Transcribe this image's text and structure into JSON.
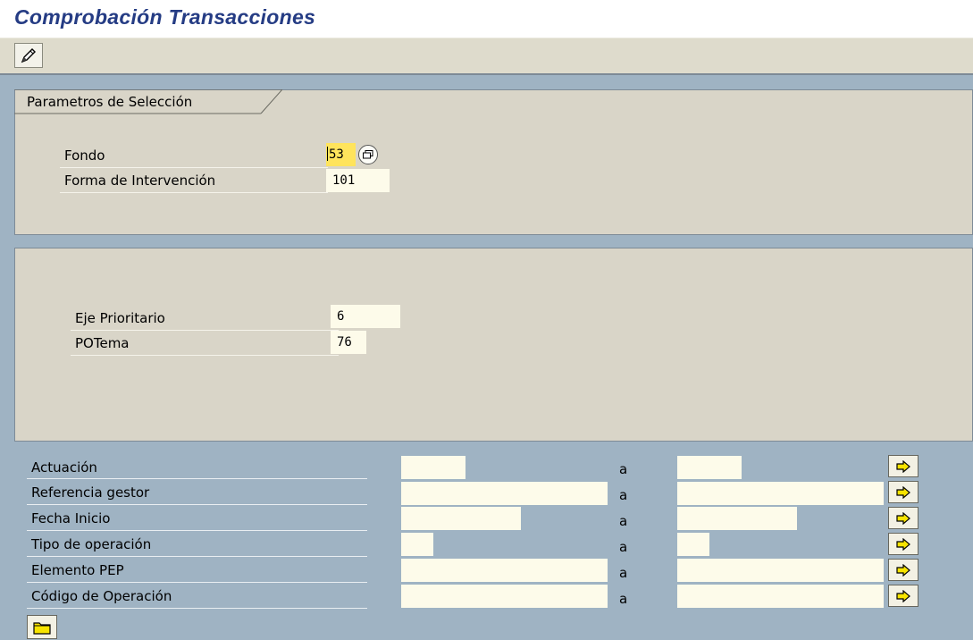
{
  "window": {
    "title": "Comprobación Transacciones"
  },
  "toolbar": {
    "edit_icon": "pencil-icon"
  },
  "group1": {
    "tab_label": "Parametros de Selección",
    "fields": [
      {
        "label": "Fondo",
        "value": "53",
        "has_help": true,
        "help_icon": "matchcode-icon"
      },
      {
        "label": "Forma de Intervención",
        "value": "101"
      }
    ]
  },
  "group2": {
    "fields": [
      {
        "label": "Eje Prioritario",
        "value": "6"
      },
      {
        "label": "POTema",
        "value": "76"
      }
    ]
  },
  "ranges": {
    "separator": "a",
    "rows": [
      {
        "label": "Actuación",
        "low": "",
        "high": ""
      },
      {
        "label": "Referencia gestor",
        "low": "",
        "high": ""
      },
      {
        "label": "Fecha Inicio",
        "low": "",
        "high": ""
      },
      {
        "label": "Tipo de operación",
        "low": "",
        "high": ""
      },
      {
        "label": "Elemento PEP",
        "low": "",
        "high": ""
      },
      {
        "label": "Código de Operación",
        "low": "",
        "high": ""
      }
    ],
    "multiple_selection_icon": "arrow-right-icon"
  },
  "footer": {
    "execute_icon": "folder-icon"
  },
  "colors": {
    "title": "#253c84",
    "field_bg": "#fdfbea",
    "group_bg": "#d9d5c8",
    "main_bg": "#9fb3c3",
    "cursor_bg": "#ffe45c",
    "arrow_yellow": "#f7e400"
  }
}
